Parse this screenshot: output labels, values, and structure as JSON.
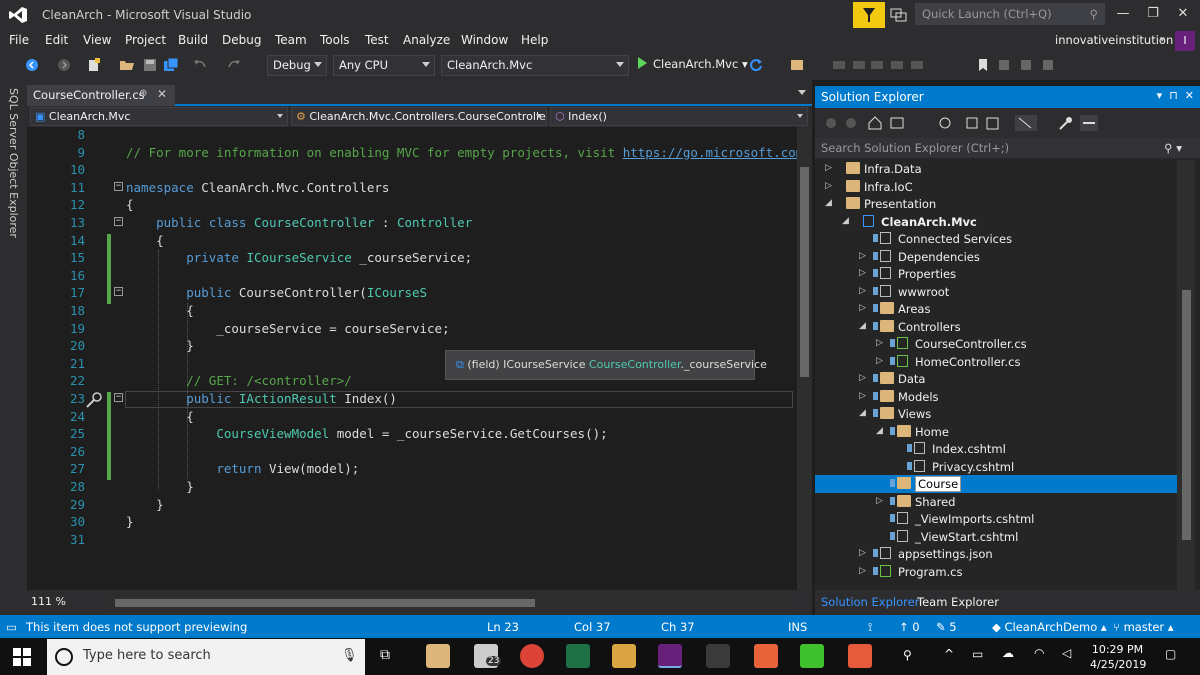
{
  "window": {
    "title": "CleanArch - Microsoft Visual Studio",
    "quick_launch_placeholder": "Quick Launch (Ctrl+Q)"
  },
  "menu": {
    "items": [
      "File",
      "Edit",
      "View",
      "Project",
      "Build",
      "Debug",
      "Team",
      "Tools",
      "Test",
      "Analyze",
      "Window",
      "Help"
    ],
    "user": "innovativeinstitution",
    "user_initial": "I"
  },
  "toolbar": {
    "configuration": "Debug",
    "platform": "Any CPU",
    "startup_project": "CleanArch.Mvc",
    "run_label": "CleanArch.Mvc"
  },
  "left_strip": {
    "label": "SQL Server Object Explorer"
  },
  "editor": {
    "tab": {
      "label": "CourseController.cs",
      "pin": "⊕",
      "close": "✕"
    },
    "nav": {
      "project": "CleanArch.Mvc",
      "class": "CleanArch.Mvc.Controllers.CourseController",
      "member": "Index()"
    },
    "zoom": "111 %",
    "tooltip": {
      "prefix": "(field) ICourseService ",
      "owner": "CourseController",
      "member": "._courseService"
    },
    "lines": [
      {
        "n": "8",
        "html": ""
      },
      {
        "n": "9",
        "html": "<span class='cm'>// For more information on enabling MVC for empty projects, visit </span><span class='lnk'>https://go.microsoft.com</span>"
      },
      {
        "n": "10",
        "html": ""
      },
      {
        "n": "11",
        "html": "<span class='kw'>namespace</span> <span class='nm'>CleanArch.Mvc.Controllers</span>"
      },
      {
        "n": "12",
        "html": "{"
      },
      {
        "n": "13",
        "html": "    <span class='kw'>public</span> <span class='kw'>class</span> <span class='ty'>CourseController</span> : <span class='ty'>Controller</span>"
      },
      {
        "n": "14",
        "html": "    {"
      },
      {
        "n": "15",
        "html": "        <span class='kw'>private</span> <span class='ty'>ICourseService</span> _courseService;"
      },
      {
        "n": "16",
        "html": ""
      },
      {
        "n": "17",
        "html": "        <span class='kw'>public</span> CourseController(<span class='ty'>ICourseS</span>"
      },
      {
        "n": "18",
        "html": "        {"
      },
      {
        "n": "19",
        "html": "            _courseService = courseService;"
      },
      {
        "n": "20",
        "html": "        }"
      },
      {
        "n": "21",
        "html": ""
      },
      {
        "n": "22",
        "html": "        <span class='cm'>// GET: /&lt;controller&gt;/</span>"
      },
      {
        "n": "23",
        "html": "        <span class='kw'>public</span> <span class='ty'>IActionResult</span> Index()"
      },
      {
        "n": "24",
        "html": "        {"
      },
      {
        "n": "25",
        "html": "            <span class='ty'>CourseViewModel</span> model = _courseService.GetCourses();"
      },
      {
        "n": "26",
        "html": ""
      },
      {
        "n": "27",
        "html": "            <span class='kw'>return</span> View(model);"
      },
      {
        "n": "28",
        "html": "        }"
      },
      {
        "n": "29",
        "html": "    }"
      },
      {
        "n": "30",
        "html": "}"
      },
      {
        "n": "31",
        "html": ""
      }
    ]
  },
  "solution_explorer": {
    "title": "Solution Explorer",
    "search_placeholder": "Search Solution Explorer (Ctrl+;)",
    "tree": [
      {
        "label": "Infra.Data",
        "level": 0,
        "exp": "▷",
        "icon": "folder-icon"
      },
      {
        "label": "Infra.IoC",
        "level": 0,
        "exp": "▷",
        "icon": "folder-icon"
      },
      {
        "label": "Presentation",
        "level": 0,
        "exp": "◢",
        "icon": "folder-open-icon"
      },
      {
        "label": "CleanArch.Mvc",
        "level": 1,
        "exp": "◢",
        "icon": "web-project-icon",
        "bold": true
      },
      {
        "label": "Connected Services",
        "level": 2,
        "exp": "",
        "icon": "cloud-icon"
      },
      {
        "label": "Dependencies",
        "level": 2,
        "exp": "▷",
        "icon": "dependencies-icon"
      },
      {
        "label": "Properties",
        "level": 2,
        "exp": "▷",
        "icon": "wrench-icon"
      },
      {
        "label": "wwwroot",
        "level": 2,
        "exp": "▷",
        "icon": "globe-icon"
      },
      {
        "label": "Areas",
        "level": 2,
        "exp": "▷",
        "icon": "folder-icon"
      },
      {
        "label": "Controllers",
        "level": 2,
        "exp": "◢",
        "icon": "folder-open-icon"
      },
      {
        "label": "CourseController.cs",
        "level": 3,
        "exp": "▷",
        "icon": "csharp-file-icon"
      },
      {
        "label": "HomeController.cs",
        "level": 3,
        "exp": "▷",
        "icon": "csharp-file-icon"
      },
      {
        "label": "Data",
        "level": 2,
        "exp": "▷",
        "icon": "folder-icon"
      },
      {
        "label": "Models",
        "level": 2,
        "exp": "▷",
        "icon": "folder-icon"
      },
      {
        "label": "Views",
        "level": 2,
        "exp": "◢",
        "icon": "folder-open-icon"
      },
      {
        "label": "Home",
        "level": 3,
        "exp": "◢",
        "icon": "folder-open-icon"
      },
      {
        "label": "Index.cshtml",
        "level": 4,
        "exp": "",
        "icon": "cshtml-file-icon"
      },
      {
        "label": "Privacy.cshtml",
        "level": 4,
        "exp": "",
        "icon": "cshtml-file-icon"
      },
      {
        "label": "Course",
        "level": 3,
        "exp": "",
        "icon": "folder-icon",
        "selected": true
      },
      {
        "label": "Shared",
        "level": 3,
        "exp": "▷",
        "icon": "folder-icon"
      },
      {
        "label": "_ViewImports.cshtml",
        "level": 3,
        "exp": "",
        "icon": "cshtml-file-icon"
      },
      {
        "label": "_ViewStart.cshtml",
        "level": 3,
        "exp": "",
        "icon": "cshtml-file-icon"
      },
      {
        "label": "appsettings.json",
        "level": 2,
        "exp": "▷",
        "icon": "json-file-icon"
      },
      {
        "label": "Program.cs",
        "level": 2,
        "exp": "▷",
        "icon": "csharp-file-icon"
      }
    ],
    "tabs": [
      "Solution Explorer",
      "Team Explorer"
    ]
  },
  "status": {
    "message": "This item does not support previewing",
    "line": "Ln 23",
    "col": "Col 37",
    "ch": "Ch 37",
    "mode": "INS",
    "up_count": "0",
    "pencil_count": "5",
    "repo": "CleanArchDemo",
    "branch": "master"
  },
  "taskbar": {
    "search_placeholder": "Type here to search",
    "mail_badge": "23",
    "time": "10:29 PM",
    "date": "4/25/2019"
  }
}
